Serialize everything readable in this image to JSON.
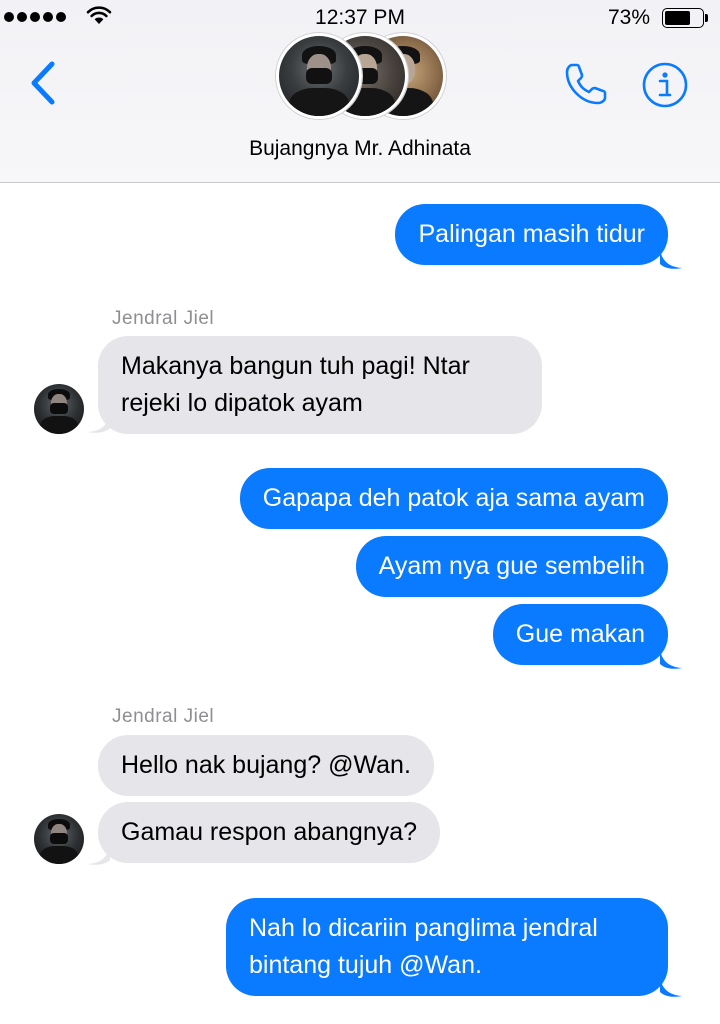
{
  "status_bar": {
    "time": "12:37 PM",
    "battery_percent": "73%",
    "battery_level": 0.73,
    "signal_dots": 5,
    "icons": [
      "signal-dots-icon",
      "wifi-icon",
      "battery-icon"
    ]
  },
  "header": {
    "chat_title": "Bujangnya Mr. Adhinata",
    "icons": [
      "chevron-left-icon",
      "phone-icon",
      "info-icon"
    ],
    "accent_color": "#0a7aff"
  },
  "messages": [
    {
      "direction": "outgoing",
      "text": "Palingan masih tidur"
    },
    {
      "direction": "incoming",
      "sender": "Jendral Jiel",
      "text_lines": [
        "Makanya bangun tuh pagi! Ntar",
        "rejeki lo dipatok ayam"
      ]
    },
    {
      "direction": "outgoing",
      "text": "Gapapa deh patok aja sama ayam"
    },
    {
      "direction": "outgoing",
      "text": "Ayam nya gue sembelih"
    },
    {
      "direction": "outgoing",
      "text": "Gue makan"
    },
    {
      "direction": "incoming",
      "sender": "Jendral Jiel",
      "text": "Hello nak bujang? @Wan."
    },
    {
      "direction": "incoming",
      "text": "Gamau respon abangnya?"
    },
    {
      "direction": "outgoing",
      "text_lines": [
        "Nah lo dicariin panglima jendral",
        "bintang tujuh @Wan."
      ]
    }
  ],
  "colors": {
    "outgoing_bubble": "#0a7aff",
    "incoming_bubble": "#e5e5ea",
    "sender_name": "#8e8e93"
  }
}
